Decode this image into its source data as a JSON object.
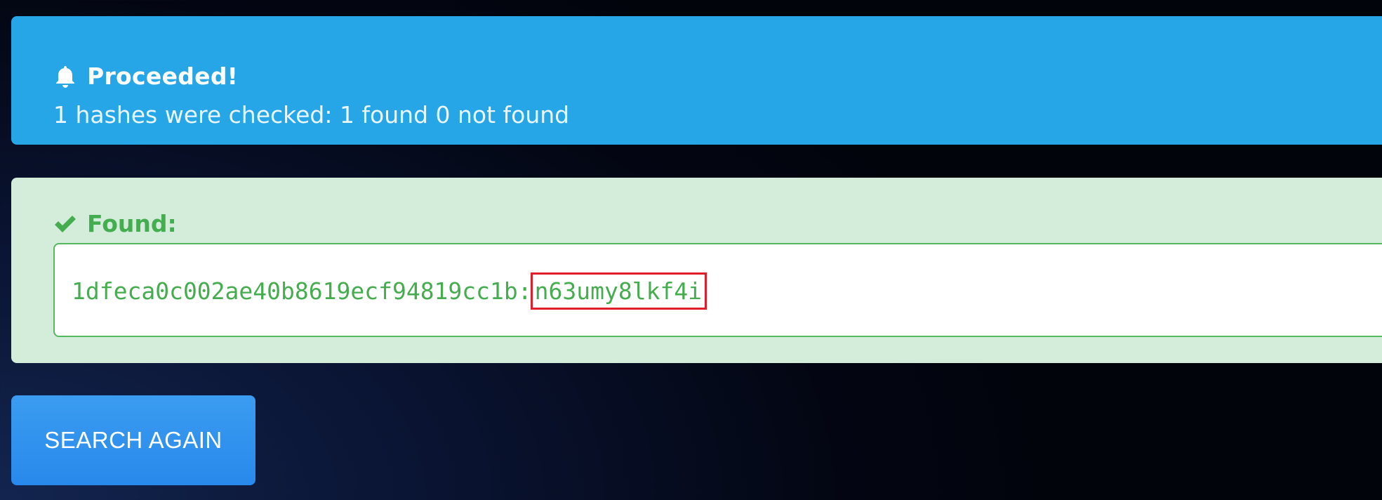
{
  "info_alert": {
    "icon": "bell-icon",
    "title": "Proceeded!",
    "message": "1 hashes were checked: 1 found 0 not found",
    "color": "#26a6e6"
  },
  "success_alert": {
    "icon": "check-icon",
    "label": "Found:",
    "result": {
      "hash": "1dfeca0c002ae40b8619ecf94819cc1b:",
      "plaintext": "n63umy8lkf4i"
    },
    "color": "#d4edda",
    "text_color": "#45ad4f",
    "highlight_color": "#e11d2a"
  },
  "actions": {
    "search_again_label": "SEARCH AGAIN",
    "button_color": "#2f93ee"
  }
}
